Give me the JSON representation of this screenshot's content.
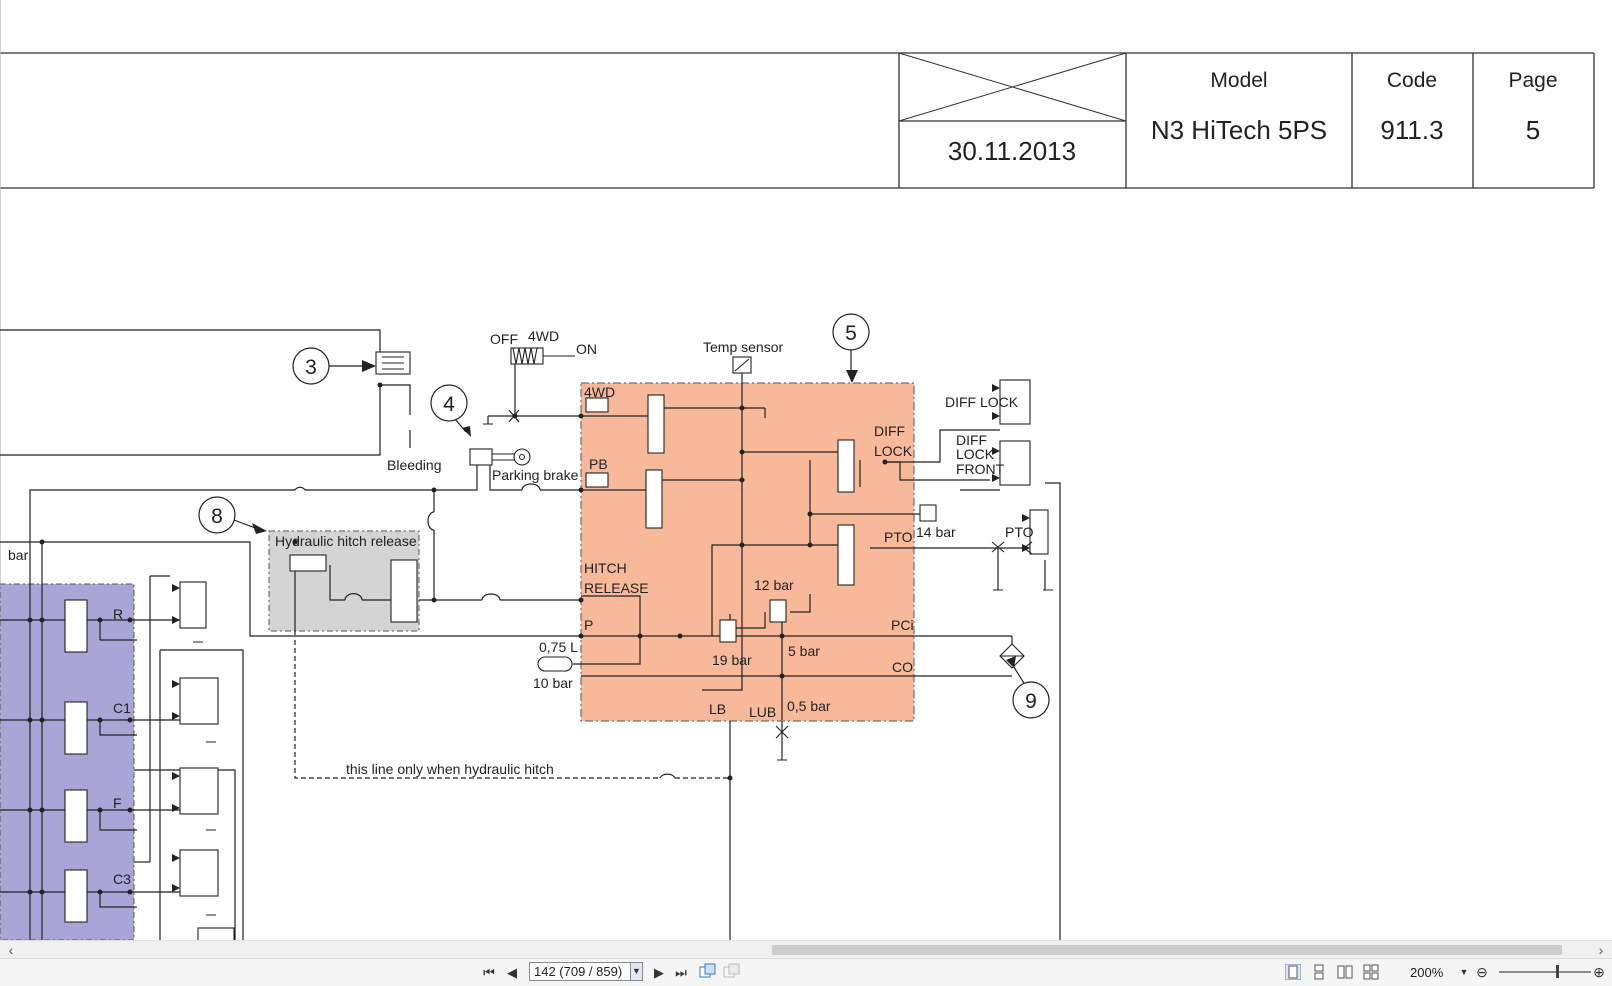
{
  "document": {
    "title_block": {
      "date": "30.11.2013",
      "model_header": "Model",
      "model_value": "N3 HiTech 5PS",
      "code_header": "Code",
      "code_value": "911.3",
      "page_header": "Page",
      "page_value": "5"
    },
    "schematic": {
      "callouts": [
        "3",
        "4",
        "5",
        "8",
        "9"
      ],
      "labels": {
        "off": "OFF",
        "fourwd_switch": "4WD",
        "on": "ON",
        "temp_sensor": "Temp sensor",
        "bleeding": "Bleeding",
        "parking_brake": "Parking brake",
        "hydraulic_hitch_release": "Hydraulic hitch release",
        "block_4wd": "4WD",
        "block_pb": "PB",
        "hitch": "HITCH",
        "release": "RELEASE",
        "p": "P",
        "diff": "DIFF",
        "lock": "LOCK",
        "diff_lock": "DIFF LOCK",
        "diff2": "DIFF",
        "lock2": "LOCK",
        "front": "FRONT",
        "pto_inner": "PTO",
        "pto_outer": "PTO",
        "bar14": "14 bar",
        "bar12": "12 bar",
        "bar5": "5 bar",
        "bar19": "19 bar",
        "pci": "PCi",
        "co": "CO",
        "lb": "LB",
        "lub": "LUB",
        "bar05": "0,5 bar",
        "acc_vol": "0,75 L",
        "bar10": "10 bar",
        "r": "R",
        "c1": "C1",
        "f": "F",
        "c3": "C3",
        "bar_edge": "bar",
        "hitch_note": "this line only when hydraulic hitch"
      }
    }
  },
  "navigation": {
    "first_page_icon": "first-page-icon",
    "prev_page_icon": "prev-page-icon",
    "page_field_value": "142 (709 / 859)",
    "next_page_icon": "next-page-icon",
    "last_page_icon": "last-page-icon",
    "zoom_value": "200%"
  },
  "colors": {
    "block_fill": "#f7b99a",
    "valve_bank_fill": "#a9a5d6",
    "hitch_box_fill": "#d4d4d4"
  }
}
